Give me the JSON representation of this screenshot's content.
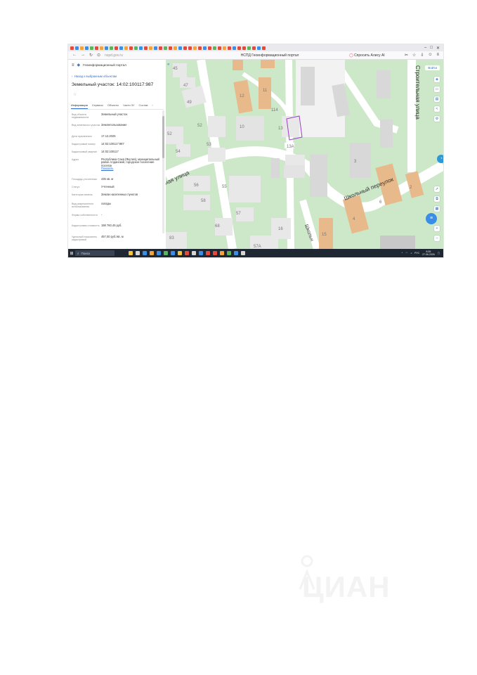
{
  "browser": {
    "url": "nspd.gov.ru",
    "page_title": "НСПД Геоинформационный портал",
    "kaspersky": "Спросить Алису AI",
    "colors": {
      "tabstrip": "#e9e9ee",
      "address": "#f9f9fb"
    }
  },
  "panel": {
    "brand": "Геоинформационный портал",
    "back_link": "Назад к выбранным объектам",
    "title": "Земельный участок: 14:02:100117:987",
    "tabs": [
      "Информация",
      "Сервисы",
      "Объекты",
      "Части ЗУ",
      "Состав"
    ],
    "rows": [
      {
        "key": "Вид объекта недвижимости",
        "value": "Земельный участок"
      },
      {
        "key": "Вид земельного участка",
        "value": "Землепользование"
      },
      {
        "key": "Дата присвоения",
        "value": "17.12.2025"
      },
      {
        "key": "Кадастровый номер",
        "value": "14:02:100117:987"
      },
      {
        "key": "Кадастровый квартал",
        "value": "14:02:100117"
      },
      {
        "key": "Адрес",
        "value": "Республика Саха (Якутия), муниципальный район Алданский, городское поселение поселок",
        "link": "Показать"
      },
      {
        "key": "Площадь уточненная",
        "value": "435 кв. м"
      },
      {
        "key": "Статус",
        "value": "Учтенный"
      },
      {
        "key": "Категория земель",
        "value": "Земли населенных пунктов"
      },
      {
        "key": "Вид разрешенного использования",
        "value": "склады"
      },
      {
        "key": "Форма собственности",
        "value": "-"
      },
      {
        "key": "Кадастровая стоимость",
        "value": "198 760,45 руб."
      },
      {
        "key": "Удельный показатель кадастровой",
        "value": "457,00 руб./кв. м"
      }
    ]
  },
  "map": {
    "login": "Войти",
    "streets": [
      "Строительная улица",
      "Школьный переулок",
      "ная улица",
      "Школьн"
    ],
    "house_numbers": [
      "45",
      "47",
      "49",
      "12",
      "11",
      "114",
      "13",
      "10",
      "52",
      "52",
      "53",
      "54",
      "56",
      "55",
      "58",
      "57",
      "68",
      "16",
      "83",
      "57А",
      "15",
      "4",
      "6",
      "3",
      "2",
      "13А"
    ],
    "colors": {
      "green": "#cde7c9",
      "road": "#ffffff",
      "building": "#d8d8d8",
      "building_orange": "#e8b98a",
      "accent": "#3a8ee6"
    }
  },
  "taskbar": {
    "search": "Поиск",
    "time": "8:35",
    "date": "27.06.2026",
    "lang": "РУС"
  },
  "watermark": {
    "text": "ЦИАН"
  }
}
